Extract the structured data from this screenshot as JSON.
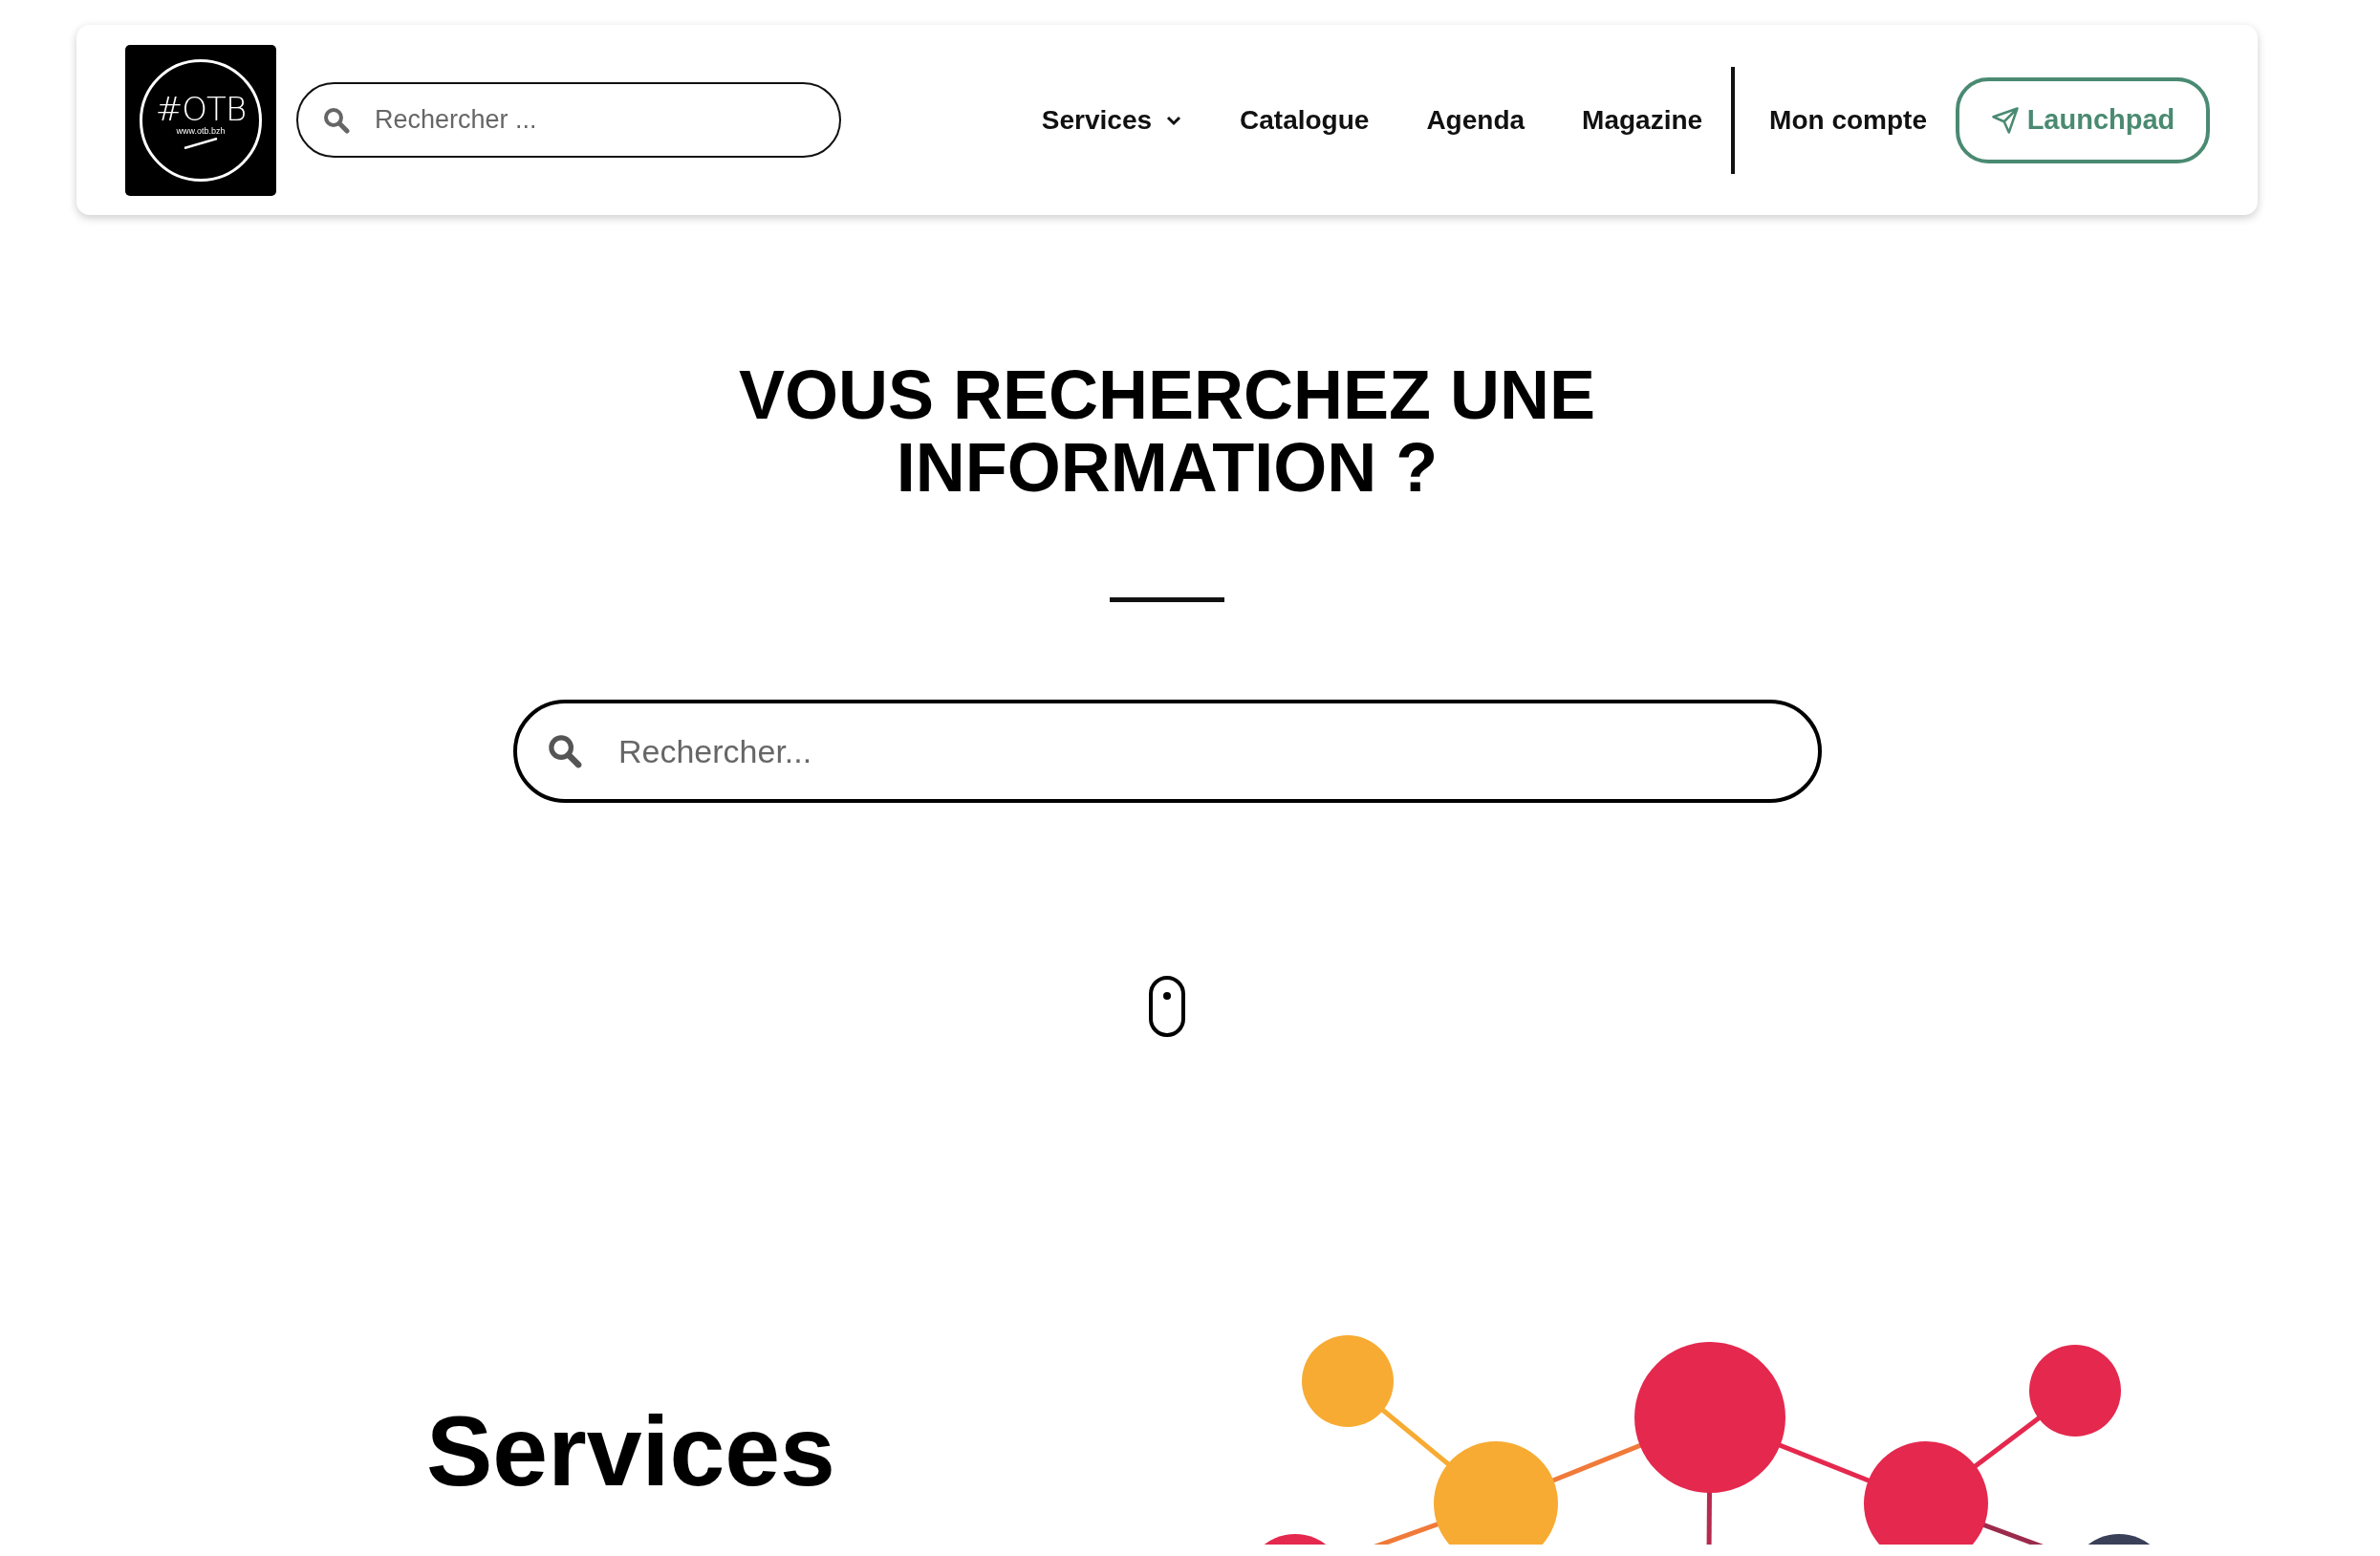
{
  "header": {
    "logo": {
      "text": "#OTB",
      "url": "www.otb.bzh"
    },
    "search": {
      "placeholder": "Rechercher ..."
    },
    "nav": [
      {
        "label": "Services",
        "dropdown": true
      },
      {
        "label": "Catalogue",
        "dropdown": false
      },
      {
        "label": "Agenda",
        "dropdown": false
      },
      {
        "label": "Magazine",
        "dropdown": false
      }
    ],
    "account": "Mon compte",
    "launchpad": "Launchpad"
  },
  "hero": {
    "title": "VOUS RECHERCHEZ UNE INFORMATION ?",
    "search": {
      "placeholder": "Rechercher..."
    }
  },
  "services": {
    "title": "Services"
  }
}
